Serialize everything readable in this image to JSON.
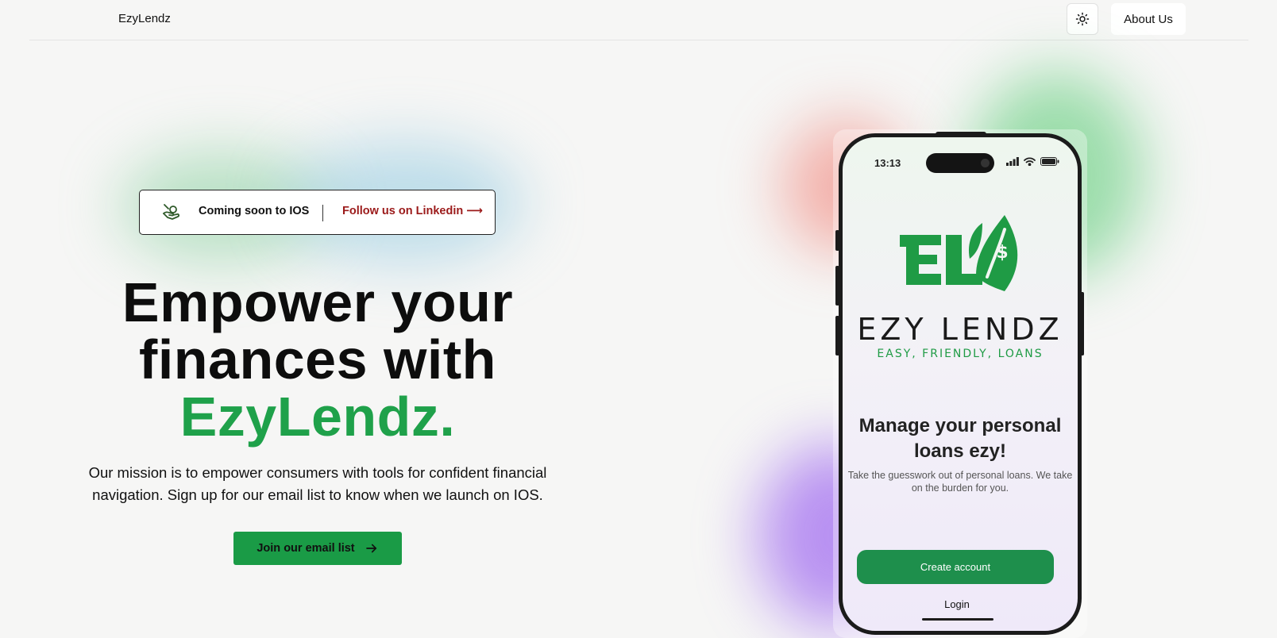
{
  "header": {
    "brand": "EzyLendz",
    "theme_toggle_icon": "sun-icon",
    "about_label": "About Us"
  },
  "badge": {
    "icon": "hand-money-icon",
    "text": "Coming soon to IOS",
    "link_label": "Follow us on Linkedin",
    "link_arrow": "⟶"
  },
  "hero": {
    "title_line1": "Empower your",
    "title_line2": "finances with",
    "title_accent": "EzyLendz.",
    "subtitle": "Our mission is to empower consumers with tools for confident financial navigation. Sign up for our email list to know when we launch on IOS.",
    "cta_label": "Join our email list",
    "cta_icon": "arrow-right-icon"
  },
  "phone": {
    "status_time": "13:13",
    "logo_wordmark": "EZY LENDZ",
    "logo_tagline": "EASY, FRIENDLY, LOANS",
    "headline": "Manage your personal loans ezy!",
    "subtext": "Take the guesswork out of personal loans. We take on the burden for you.",
    "create_account_label": "Create account",
    "login_label": "Login"
  },
  "colors": {
    "brand_green": "#1fa14a",
    "cta_green": "#1a9b46",
    "link_red": "#9b1a1a",
    "app_button_green": "#1e8f4c"
  }
}
